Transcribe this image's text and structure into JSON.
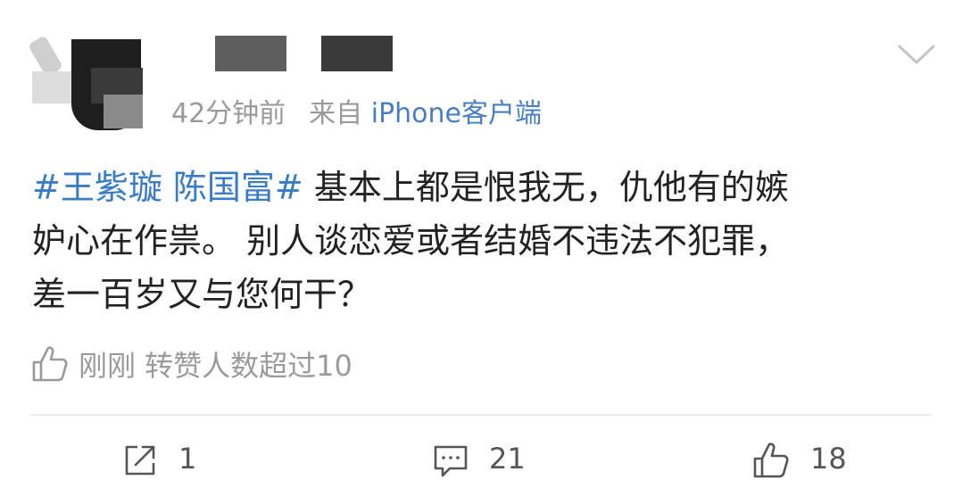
{
  "post": {
    "time": "42分钟前",
    "source_prefix": "来自",
    "source": "iPhone客户端",
    "topic": "#王紫璇 陈国富#",
    "text_line1_rest": " 基本上都是恨我无，仇他有的嫉",
    "text_line2": "妒心在作祟。 别人谈恋爱或者结婚不违法不犯罪，",
    "text_line3": "差一百岁又与您何干？"
  },
  "like_info": {
    "icon": "thumbs-up-icon",
    "text": "刚刚 转赞人数超过10"
  },
  "actions": {
    "repost_icon": "share-icon",
    "repost_count": "1",
    "comment_icon": "comment-icon",
    "comment_count": "21",
    "like_icon": "thumbs-up-icon",
    "like_count": "18"
  },
  "colors": {
    "link": "#3a7cc3",
    "meta": "#9a9a9a",
    "text": "#222222"
  }
}
